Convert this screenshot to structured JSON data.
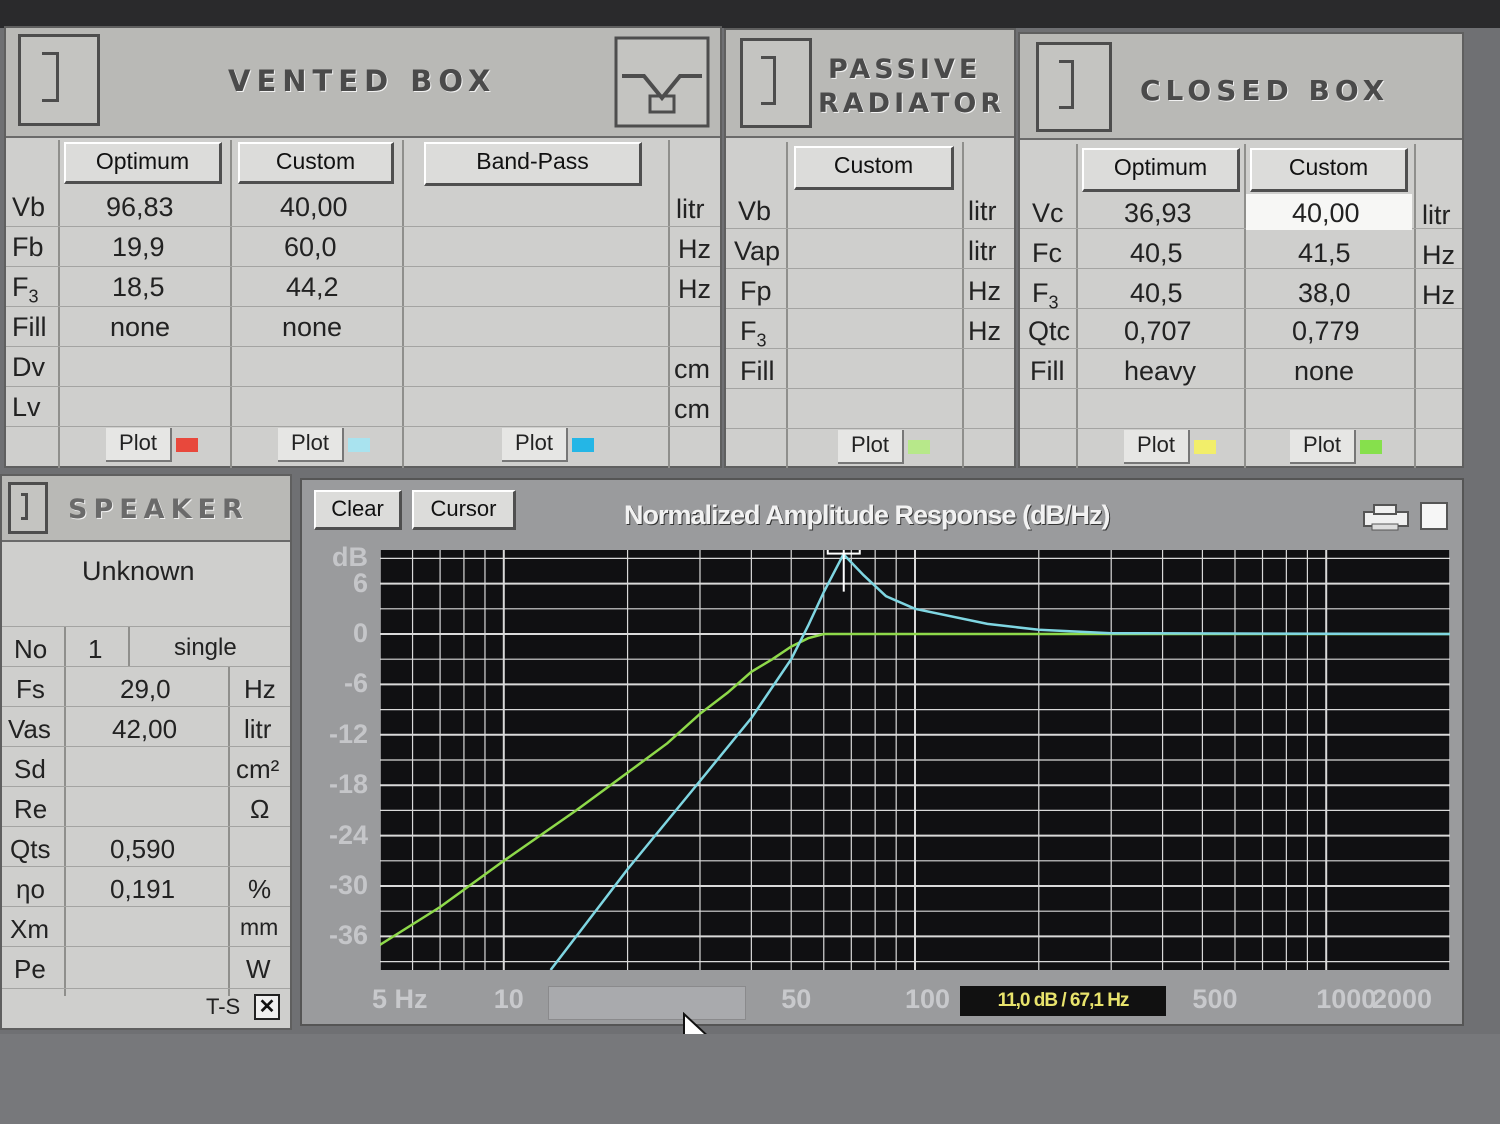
{
  "vented": {
    "title": "VENTED BOX",
    "cols": [
      "Optimum",
      "Custom",
      "Band-Pass"
    ],
    "rows": [
      {
        "label": "Vb",
        "opt": "96,83",
        "cust": "40,00",
        "bp": "",
        "unit": "litr"
      },
      {
        "label": "Fb",
        "opt": "19,9",
        "cust": "60,0",
        "bp": "",
        "unit": "Hz"
      },
      {
        "label": "F3",
        "opt": "18,5",
        "cust": "44,2",
        "bp": "",
        "unit": "Hz"
      },
      {
        "label": "Fill",
        "opt": "none",
        "cust": "none",
        "bp": "",
        "unit": ""
      },
      {
        "label": "Dv",
        "opt": "",
        "cust": "",
        "bp": "",
        "unit": "cm"
      },
      {
        "label": "Lv",
        "opt": "",
        "cust": "",
        "bp": "",
        "unit": "cm"
      }
    ],
    "plot_label": "Plot",
    "plot_colors": [
      "#e8483c",
      "#a9e3ef",
      "#24b6e6"
    ]
  },
  "passive": {
    "title_line1": "PASSIVE",
    "title_line2": "RADIATOR",
    "col": "Custom",
    "rows": [
      {
        "label": "Vb",
        "val": "",
        "unit": "litr"
      },
      {
        "label": "Vap",
        "val": "",
        "unit": "litr"
      },
      {
        "label": "Fp",
        "val": "",
        "unit": "Hz"
      },
      {
        "label": "F3",
        "val": "",
        "unit": "Hz"
      },
      {
        "label": "Fill",
        "val": "",
        "unit": ""
      }
    ],
    "plot_label": "Plot",
    "plot_color": "#b7e88a"
  },
  "closed": {
    "title": "CLOSED BOX",
    "cols": [
      "Optimum",
      "Custom"
    ],
    "rows": [
      {
        "label": "Vc",
        "opt": "36,93",
        "cust": "40,00",
        "unit": "litr"
      },
      {
        "label": "Fc",
        "opt": "40,5",
        "cust": "41,5",
        "unit": "Hz"
      },
      {
        "label": "F3",
        "opt": "40,5",
        "cust": "38,0",
        "unit": "Hz"
      },
      {
        "label": "Qtc",
        "opt": "0,707",
        "cust": "0,779",
        "unit": ""
      },
      {
        "label": "Fill",
        "opt": "heavy",
        "cust": "none",
        "unit": ""
      }
    ],
    "plot_label": "Plot",
    "plot_colors": [
      "#f2ee6a",
      "#86e04c"
    ]
  },
  "speaker": {
    "title": "SPEAKER",
    "name": "Unknown",
    "no_label": "No",
    "no_value": "1",
    "no_mode": "single",
    "params": [
      {
        "label": "Fs",
        "val": "29,0",
        "unit": "Hz"
      },
      {
        "label": "Vas",
        "val": "42,00",
        "unit": "litr"
      },
      {
        "label": "Sd",
        "val": "",
        "unit": "cm²"
      },
      {
        "label": "Re",
        "val": "",
        "unit": "Ω"
      },
      {
        "label": "Qts",
        "val": "0,590",
        "unit": ""
      },
      {
        "label": "ηo",
        "val": "0,191",
        "unit": "%"
      },
      {
        "label": "Xm",
        "val": "",
        "unit": "mm"
      },
      {
        "label": "Pe",
        "val": "",
        "unit": "W"
      }
    ],
    "ts_label": "T-S",
    "ts_checked": "✕"
  },
  "graph": {
    "clear_label": "Clear",
    "cursor_label": "Cursor",
    "title": "Normalized Amplitude Response (dB/Hz)",
    "cursor_readout": "11,0 dB / 67,1 Hz",
    "background": "#101012",
    "grid_color": "#d9d9d9",
    "icon": "printer-icon"
  },
  "chart_data": {
    "type": "line",
    "title": "Normalized Amplitude Response (dB/Hz)",
    "xlabel": "Hz",
    "ylabel": "dB",
    "x_scale": "log",
    "xlim": [
      5,
      2000
    ],
    "ylim": [
      -40,
      10
    ],
    "y_ticks": [
      "dB",
      "6",
      "0",
      "-6",
      "-12",
      "-18",
      "-24",
      "-30",
      "-36"
    ],
    "x_ticks": [
      "5 Hz",
      "10",
      "50",
      "100",
      "500",
      "1000",
      "2000"
    ],
    "x_tick_values": [
      5,
      10,
      50,
      100,
      500,
      1000,
      2000
    ],
    "grid": true,
    "series": [
      {
        "color": "#8ed94a",
        "points": [
          [
            5,
            -37
          ],
          [
            7,
            -32.5
          ],
          [
            10,
            -27
          ],
          [
            15,
            -21
          ],
          [
            20,
            -16.5
          ],
          [
            25,
            -13
          ],
          [
            30,
            -9.5
          ],
          [
            35,
            -7
          ],
          [
            40,
            -4.5
          ],
          [
            45,
            -3
          ],
          [
            50,
            -1.5
          ],
          [
            55,
            -0.5
          ],
          [
            60,
            0
          ],
          [
            100,
            0
          ],
          [
            2000,
            0
          ]
        ]
      },
      {
        "color": "#7fd6e2",
        "points": [
          [
            13,
            -40
          ],
          [
            20,
            -28
          ],
          [
            30,
            -17.5
          ],
          [
            40,
            -10
          ],
          [
            50,
            -3
          ],
          [
            55,
            1
          ],
          [
            60,
            5
          ],
          [
            67,
            9.5
          ],
          [
            75,
            7
          ],
          [
            85,
            4.5
          ],
          [
            100,
            3
          ],
          [
            150,
            1.2
          ],
          [
            200,
            0.5
          ],
          [
            300,
            0.1
          ],
          [
            2000,
            0
          ]
        ]
      }
    ],
    "cursor": {
      "x": 67.1,
      "y": 11.0
    }
  }
}
